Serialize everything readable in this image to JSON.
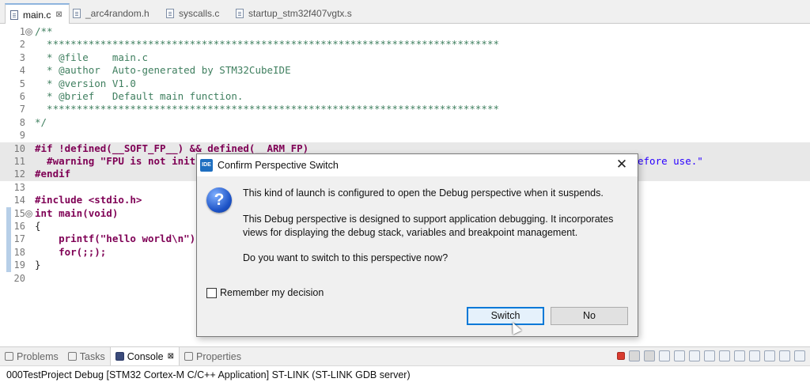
{
  "editor_tabs": [
    {
      "label": "main.c",
      "active": true
    },
    {
      "label": "_arc4random.h",
      "active": false
    },
    {
      "label": "syscalls.c",
      "active": false
    },
    {
      "label": "startup_stm32f407vgtx.s",
      "active": false
    }
  ],
  "tab_close_glyph": "⊠",
  "code": {
    "lines": [
      {
        "n": "1",
        "fold": "⊖",
        "text": "/**"
      },
      {
        "n": "2",
        "text": "  ****************************************************************************"
      },
      {
        "n": "3",
        "text": "  * @file    main.c"
      },
      {
        "n": "4",
        "text": "  * @author  Auto-generated by STM32CubeIDE"
      },
      {
        "n": "5",
        "text": "  * @version V1.0"
      },
      {
        "n": "6",
        "text": "  * @brief   Default main function."
      },
      {
        "n": "7",
        "text": "  ****************************************************************************"
      },
      {
        "n": "8",
        "text": "*/"
      },
      {
        "n": "9",
        "text": ""
      },
      {
        "n": "10",
        "text": "#if !defined(__SOFT_FP__) && defined(__ARM_FP)"
      },
      {
        "n": "11",
        "text": "  #warning \"FPU is not initi",
        "tail": "efore use.\""
      },
      {
        "n": "12",
        "text": "#endif"
      },
      {
        "n": "13",
        "text": ""
      },
      {
        "n": "14",
        "text": "#include <stdio.h>"
      },
      {
        "n": "15",
        "fold": "⊖",
        "text": "int main(void)"
      },
      {
        "n": "16",
        "text": "{"
      },
      {
        "n": "17",
        "text": "    printf(\"hello world\\n\");"
      },
      {
        "n": "18",
        "text": "    for(;;);"
      },
      {
        "n": "19",
        "text": "}"
      },
      {
        "n": "20",
        "text": ""
      }
    ]
  },
  "scroll_left_glyph": "<",
  "bottom_panel": {
    "tabs": [
      {
        "label": "Problems",
        "active": false
      },
      {
        "label": "Tasks",
        "active": false
      },
      {
        "label": "Console",
        "active": true
      },
      {
        "label": "Properties",
        "active": false
      }
    ],
    "console_title": "000TestProject Debug [STM32 Cortex-M C/C++ Application] ST-LINK (ST-LINK GDB server)"
  },
  "dialog": {
    "badge": "IDE",
    "title": "Confirm Perspective Switch",
    "close_glyph": "✕",
    "icon_glyph": "?",
    "message1": "This kind of launch is configured to open the Debug perspective when it suspends.",
    "message2a": "This Debug perspective is designed to support application debugging. It incorporates",
    "message2b": "views for displaying the debug stack, variables and breakpoint management.",
    "message3": "Do you want to switch to this perspective now?",
    "remember_label": "Remember my decision",
    "remember_checked": false,
    "switch_label": "Switch",
    "no_label": "No"
  },
  "colors": {
    "accent": "#0078d7",
    "comment": "#3f7f5f",
    "keyword": "#7f0055",
    "string": "#2a00ff"
  }
}
